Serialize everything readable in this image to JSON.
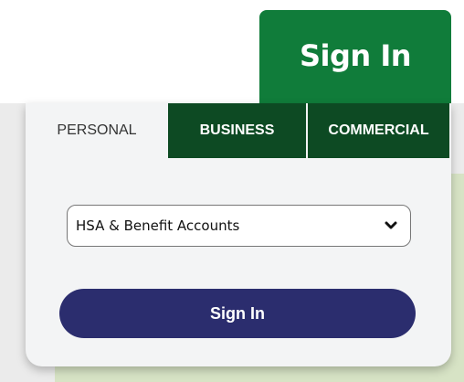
{
  "header": {
    "signin_label": "Sign In"
  },
  "tabs": [
    {
      "label": "PERSONAL",
      "selected": true
    },
    {
      "label": "BUSINESS",
      "selected": false
    },
    {
      "label": "COMMERCIAL",
      "selected": false
    }
  ],
  "account_select": {
    "selected_value": "HSA & Benefit Accounts",
    "icon": "chevron-down-icon"
  },
  "signin_button": {
    "label": "Sign In"
  },
  "colors": {
    "header_green": "#107c3a",
    "tab_dark_green": "#0d4a23",
    "button_navy": "#2b2d6e",
    "panel_bg": "#f3f4f5"
  }
}
